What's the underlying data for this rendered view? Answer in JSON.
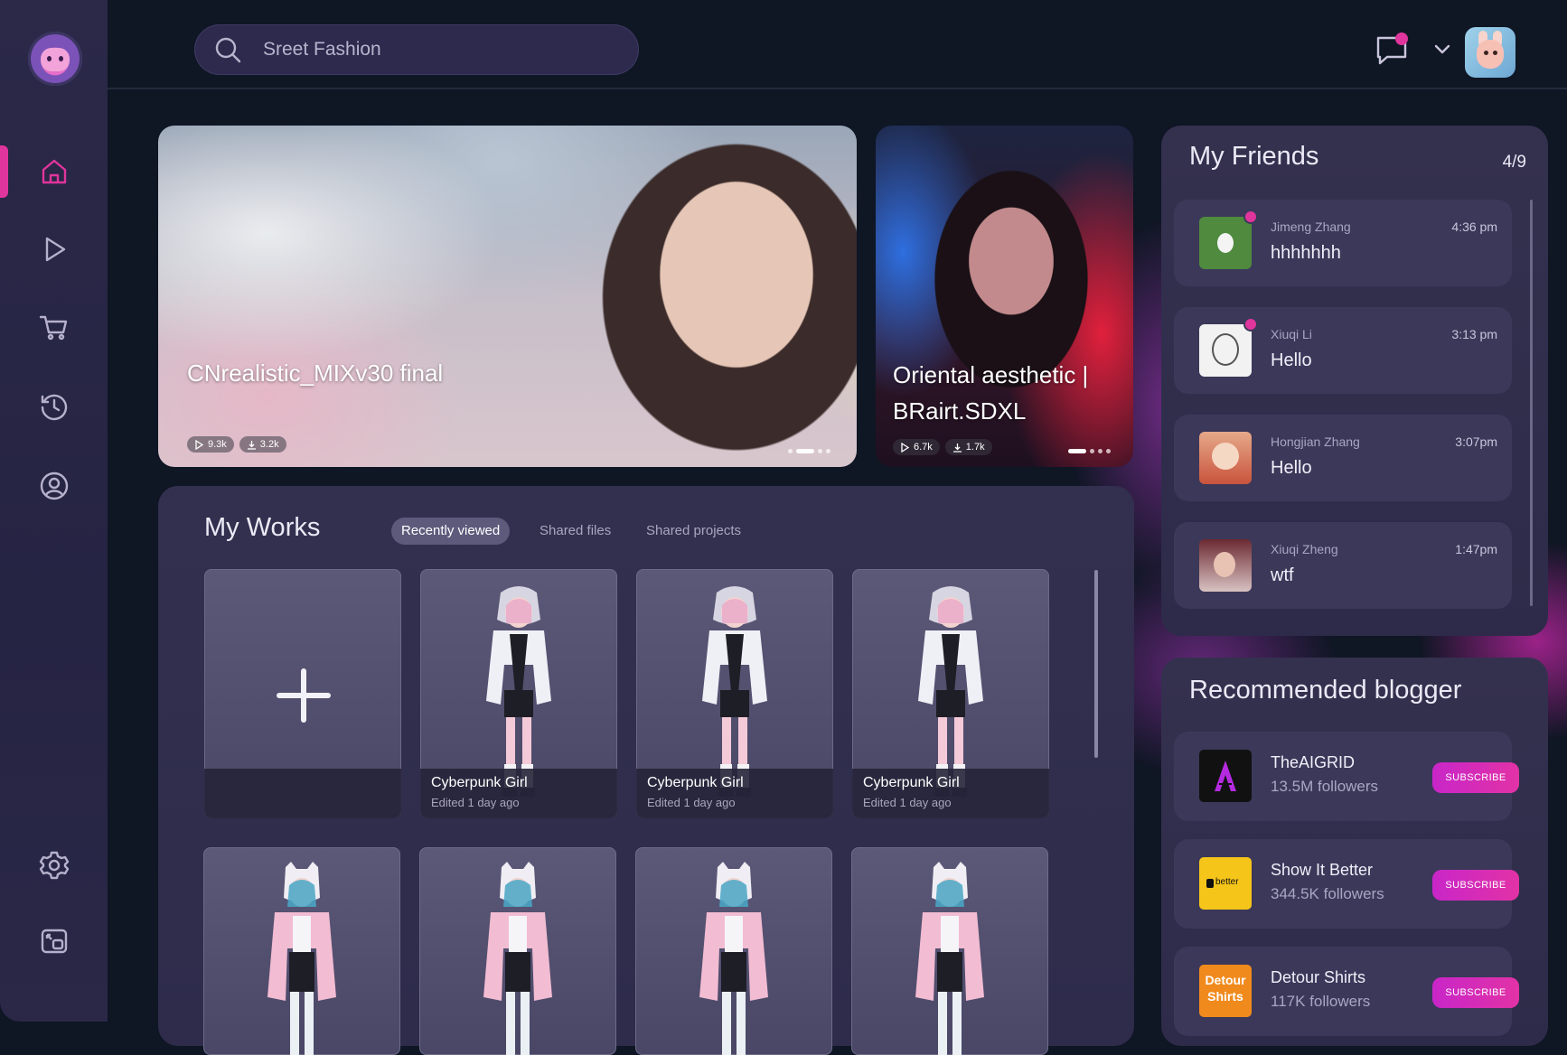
{
  "search": {
    "placeholder": "Sreet Fashion"
  },
  "hero": [
    {
      "title": "CNrealistic_MIXv30 final",
      "views": "9.3k",
      "downloads": "3.2k"
    },
    {
      "title": "Oriental aesthetic | BRairt.SDXL",
      "views": "6.7k",
      "downloads": "1.7k"
    }
  ],
  "works": {
    "title": "My Works",
    "tabs": [
      "Recently viewed",
      "Shared files",
      "Shared projects"
    ],
    "cards": [
      {
        "title": "Cyberpunk Girl",
        "edited": "Edited 1 day ago"
      },
      {
        "title": "Cyberpunk Girl",
        "edited": "Edited 1 day ago"
      },
      {
        "title": "Cyberpunk Girl",
        "edited": "Edited 1 day ago"
      }
    ]
  },
  "friends": {
    "title": "My Friends",
    "count": "4/9",
    "items": [
      {
        "name": "Jimeng Zhang",
        "message": "hhhhhhh",
        "time": "4:36 pm"
      },
      {
        "name": "Xiuqi Li",
        "message": "Hello",
        "time": "3:13 pm"
      },
      {
        "name": "Hongjian Zhang",
        "message": "Hello",
        "time": "3:07pm"
      },
      {
        "name": "Xiuqi Zheng",
        "message": "wtf",
        "time": "1:47pm"
      }
    ]
  },
  "blogger": {
    "title": "Recommended blogger",
    "subscribe_label": "SUBSCRIBE",
    "items": [
      {
        "name": "TheAIGRID",
        "followers": "13.5M followers",
        "logo_text": ""
      },
      {
        "name": "Show It Better",
        "followers": "344.5K followers",
        "logo_text": "better"
      },
      {
        "name": "Detour Shirts",
        "followers": "117K followers",
        "logo_text": "Detour Shirts"
      }
    ]
  },
  "colors": {
    "accent": "#e0359c",
    "background": "#0f1624",
    "panel": "#34314f"
  }
}
